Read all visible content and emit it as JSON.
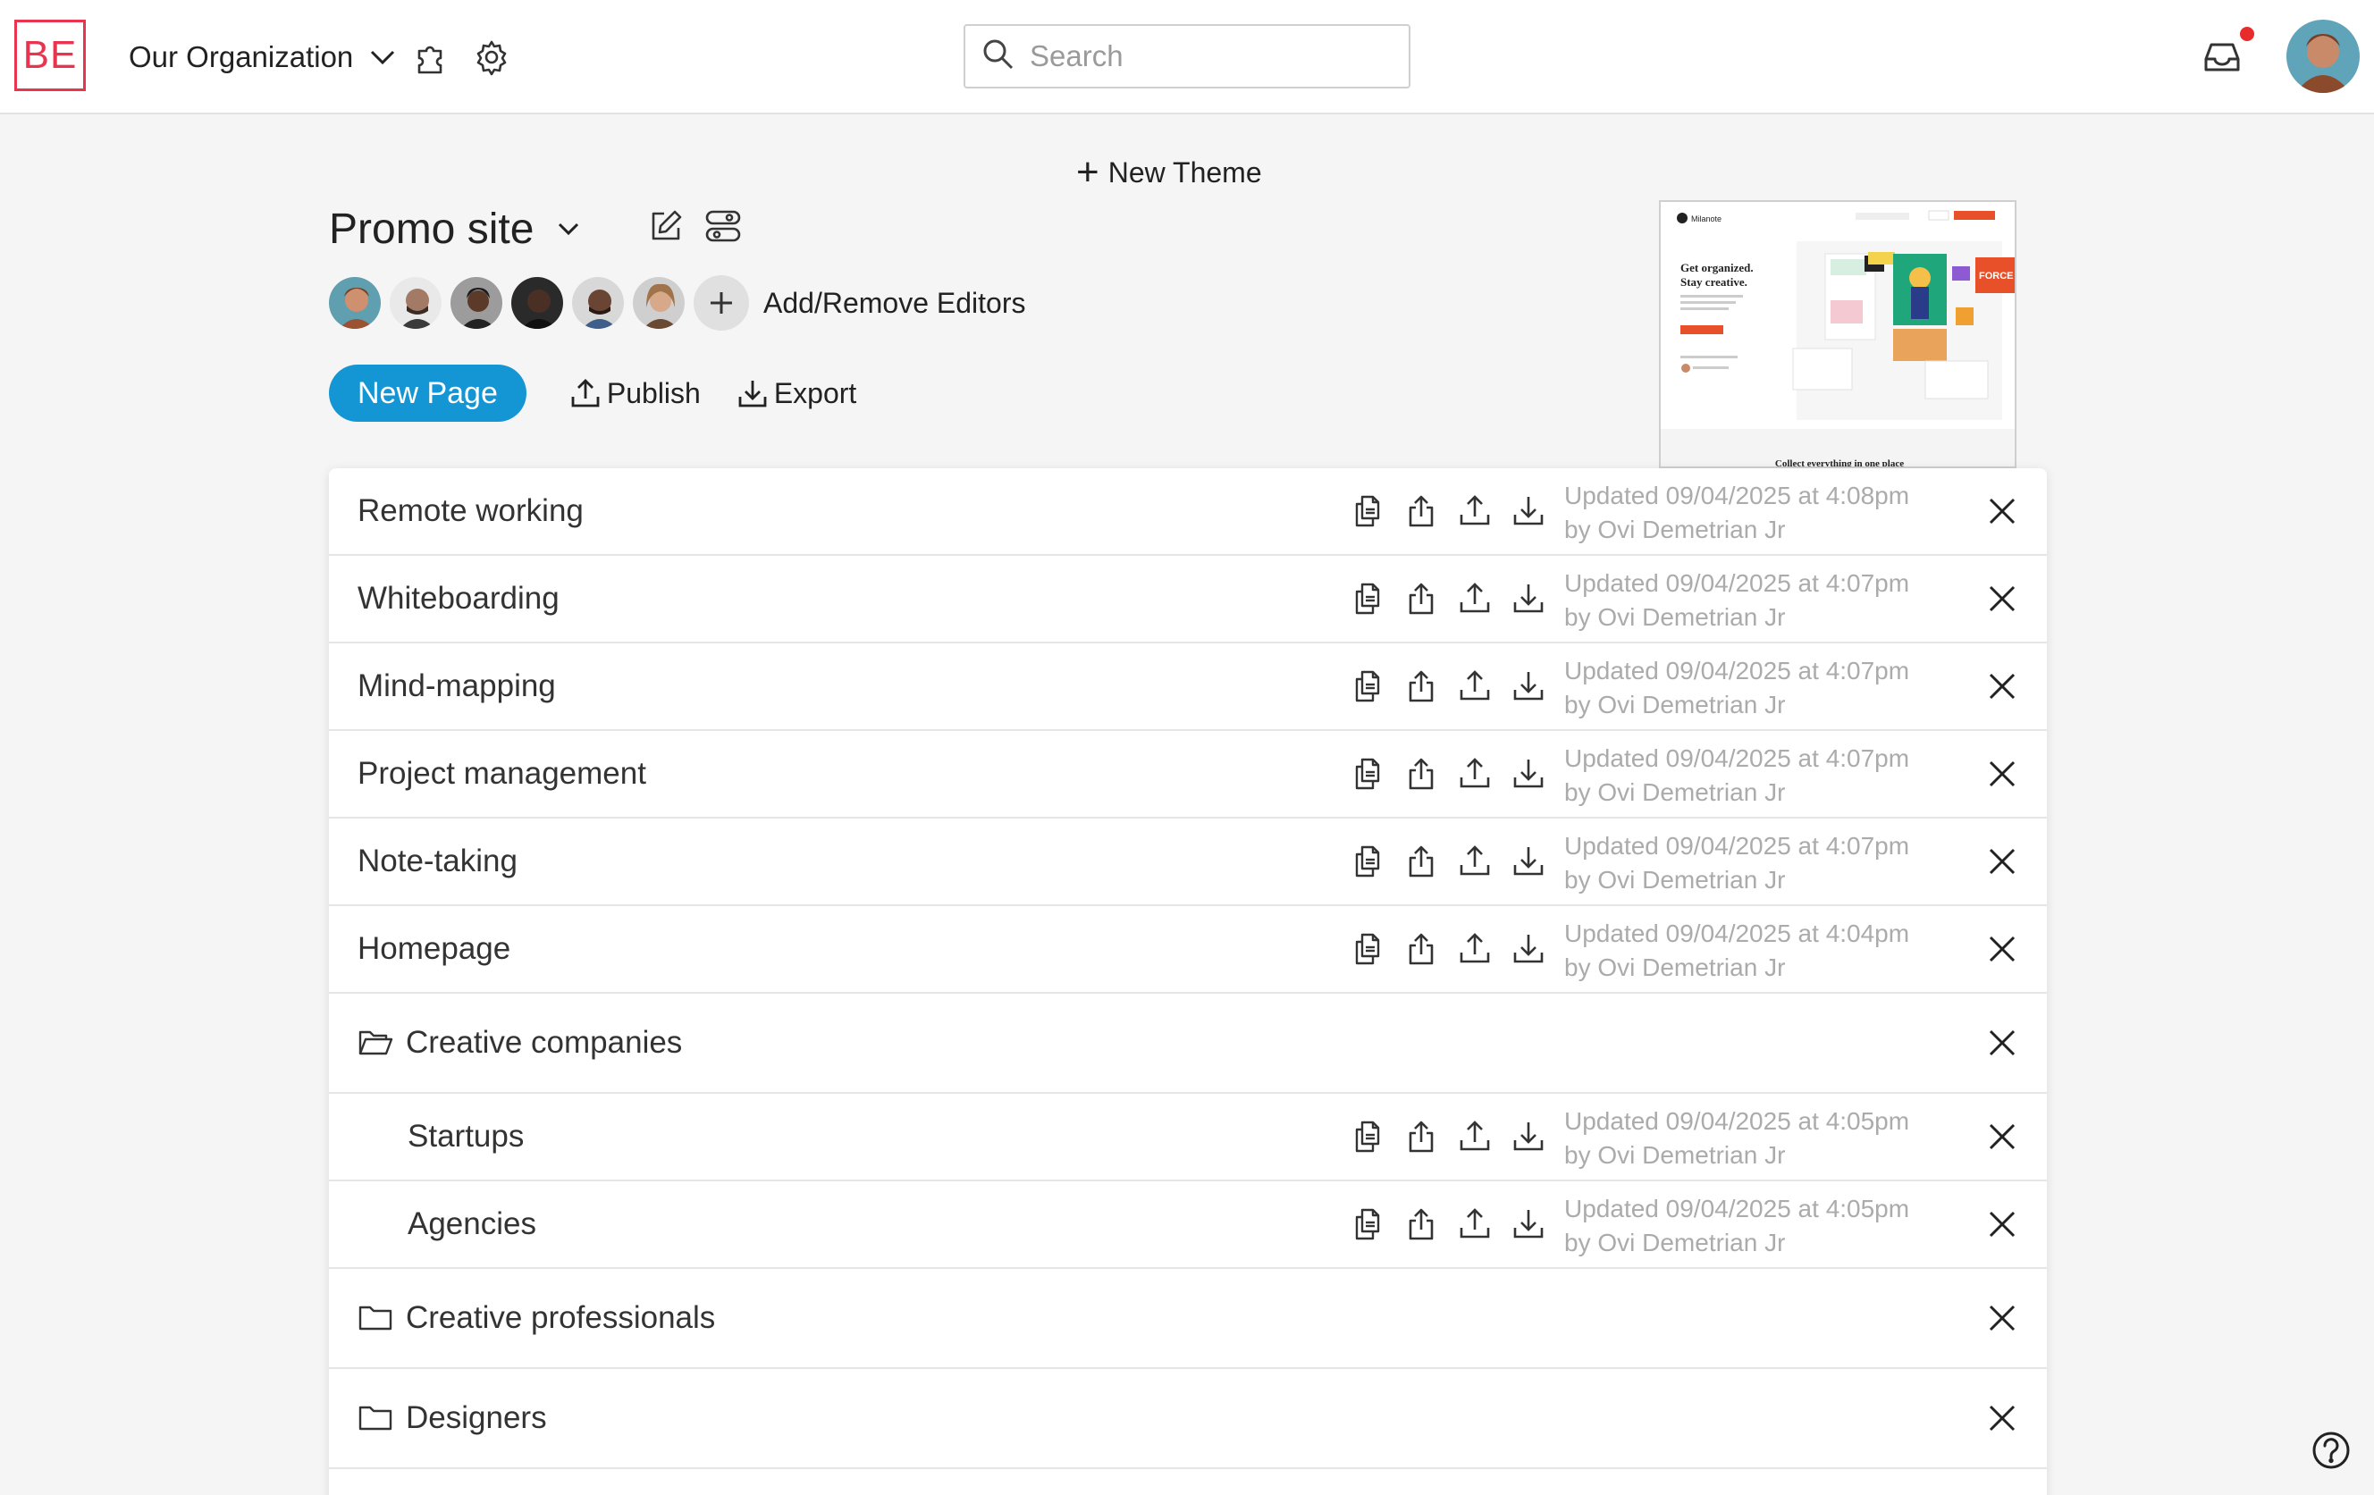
{
  "header": {
    "logo_text": "BE",
    "organization": "Our Organization",
    "search_placeholder": "Search",
    "has_notification": true
  },
  "theme": {
    "new_theme_label": "New Theme"
  },
  "site": {
    "title": "Promo site",
    "add_remove_editors_label": "Add/Remove Editors",
    "editor_count": 6
  },
  "actions": {
    "new_page": "New Page",
    "publish": "Publish",
    "export": "Export"
  },
  "preview": {
    "brand": "Milanote",
    "headline_1": "Get organized.",
    "headline_2": "Stay creative.",
    "caption": "Collect everything in one place",
    "badge": "FORCE"
  },
  "pages": [
    {
      "name": "Remote working",
      "updated": "Updated 09/04/2025 at 4:08pm",
      "by": "by Ovi Demetrian Jr"
    },
    {
      "name": "Whiteboarding",
      "updated": "Updated 09/04/2025 at 4:07pm",
      "by": "by Ovi Demetrian Jr"
    },
    {
      "name": "Mind-mapping",
      "updated": "Updated 09/04/2025 at 4:07pm",
      "by": "by Ovi Demetrian Jr"
    },
    {
      "name": "Project management",
      "updated": "Updated 09/04/2025 at 4:07pm",
      "by": "by Ovi Demetrian Jr"
    },
    {
      "name": "Note-taking",
      "updated": "Updated 09/04/2025 at 4:07pm",
      "by": "by Ovi Demetrian Jr"
    },
    {
      "name": "Homepage",
      "updated": "Updated 09/04/2025 at 4:04pm",
      "by": "by Ovi Demetrian Jr"
    }
  ],
  "folders": [
    {
      "name": "Creative companies",
      "open": true,
      "pages": [
        {
          "name": "Startups",
          "updated": "Updated 09/04/2025 at 4:05pm",
          "by": "by Ovi Demetrian Jr"
        },
        {
          "name": "Agencies",
          "updated": "Updated 09/04/2025 at 4:05pm",
          "by": "by Ovi Demetrian Jr"
        }
      ]
    },
    {
      "name": "Creative professionals",
      "open": false
    },
    {
      "name": "Designers",
      "open": false
    }
  ],
  "colors": {
    "brand_red": "#e8344e",
    "primary_blue": "#1596d4",
    "notification_red": "#e82b2b",
    "meta_gray": "#ababab"
  }
}
